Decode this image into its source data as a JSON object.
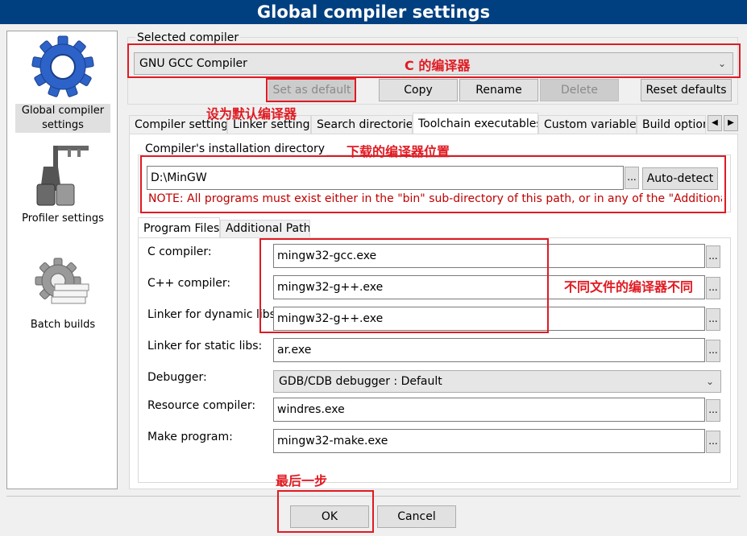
{
  "window": {
    "title": "Global compiler settings"
  },
  "sidebar": {
    "items": [
      {
        "label": "Global compiler settings",
        "icon": "gear-icon",
        "selected": true
      },
      {
        "label": "Profiler settings",
        "icon": "profiler-icon",
        "selected": false
      },
      {
        "label": "Batch builds",
        "icon": "batch-gear-icon",
        "selected": false
      }
    ]
  },
  "compiler": {
    "group_label": "Selected compiler",
    "selected": "GNU GCC Compiler",
    "buttons": {
      "set_default": "Set as default",
      "copy": "Copy",
      "rename": "Rename",
      "delete": "Delete",
      "reset": "Reset defaults"
    }
  },
  "tabs": [
    "Compiler settings",
    "Linker settings",
    "Search directories",
    "Toolchain executables",
    "Custom variables",
    "Build options"
  ],
  "active_tab": "Toolchain executables",
  "install": {
    "group_label": "Compiler's installation directory",
    "path": "D:\\MinGW",
    "browse": "...",
    "auto_detect": "Auto-detect",
    "note": "NOTE: All programs must exist either in the \"bin\" sub-directory of this path, or in any of the \"Additional"
  },
  "subtabs": [
    "Program Files",
    "Additional Paths"
  ],
  "programs": {
    "c_compiler": {
      "label": "C compiler:",
      "value": "mingw32-gcc.exe"
    },
    "cpp_compiler": {
      "label": "C++ compiler:",
      "value": "mingw32-g++.exe"
    },
    "linker_dynamic": {
      "label": "Linker for dynamic libs:",
      "value": "mingw32-g++.exe"
    },
    "linker_static": {
      "label": "Linker for static libs:",
      "value": "ar.exe"
    },
    "debugger": {
      "label": "Debugger:",
      "value": "GDB/CDB debugger : Default"
    },
    "resource_compiler": {
      "label": "Resource compiler:",
      "value": "windres.exe"
    },
    "make": {
      "label": "Make program:",
      "value": "mingw32-make.exe"
    }
  },
  "footer": {
    "ok": "OK",
    "cancel": "Cancel"
  },
  "annotations": {
    "c_compiler_note": "C 的编译器",
    "set_default_note": "设为默认编译器",
    "install_note": "下载的编译器位置",
    "programs_note": "不同文件的编译器不同",
    "last_step": "最后一步"
  },
  "colors": {
    "titlebar": "#003f80",
    "annotation_red": "#e01a22",
    "note_red": "#c00000"
  }
}
